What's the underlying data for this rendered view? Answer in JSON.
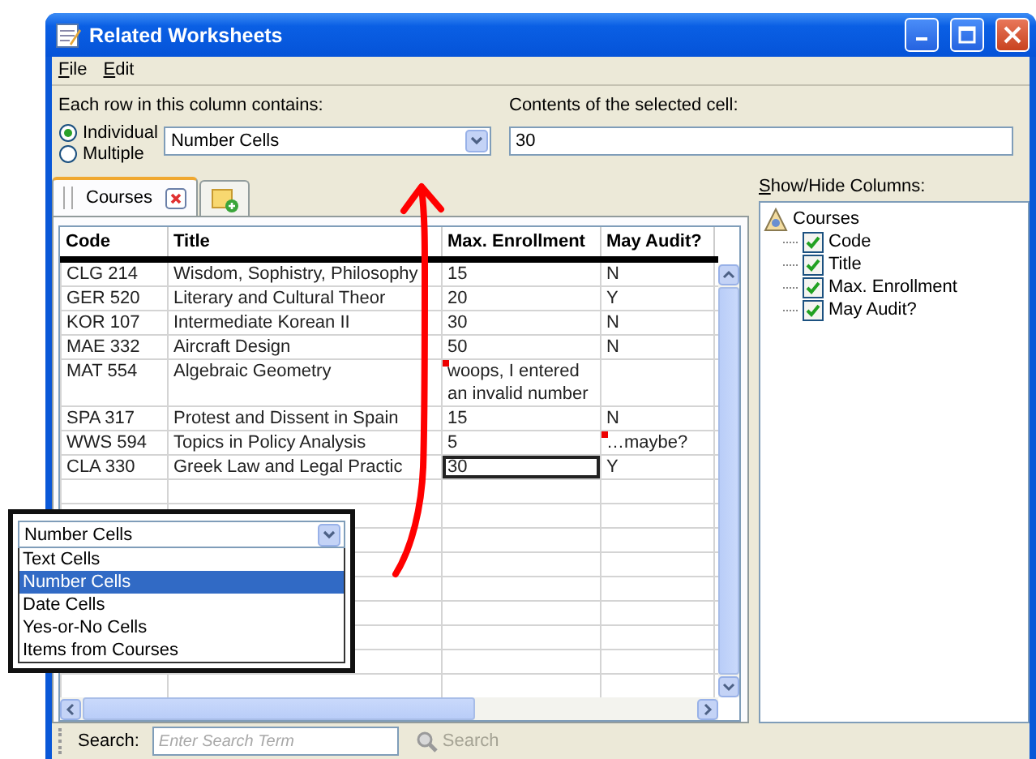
{
  "window": {
    "title": "Related Worksheets"
  },
  "menu": [
    "File",
    "Edit"
  ],
  "row_content": {
    "label": "Each row in this column contains:",
    "options": [
      {
        "label": "Individual",
        "selected": true
      },
      {
        "label": "Multiple",
        "selected": false
      }
    ],
    "type_dropdown": {
      "value": "Number Cells"
    }
  },
  "cell_contents": {
    "label": "Contents of the selected cell:",
    "value": "30"
  },
  "tabs": [
    {
      "kind": "sheet",
      "label": "Courses",
      "selected": true
    },
    {
      "kind": "add",
      "selected": false
    }
  ],
  "table": {
    "columns": [
      "Code",
      "Title",
      "Max. Enrollment",
      "May Audit?"
    ],
    "rows": [
      {
        "cells": [
          {
            "text": "CLG 214",
            "selected": false,
            "flagged": false
          },
          {
            "text": "Wisdom, Sophistry, Philosophy",
            "selected": false,
            "flagged": false
          },
          {
            "text": "15",
            "selected": false,
            "flagged": false
          },
          {
            "text": "N",
            "selected": false,
            "flagged": false
          }
        ]
      },
      {
        "cells": [
          {
            "text": "GER 520",
            "selected": false,
            "flagged": false
          },
          {
            "text": "Literary and Cultural Theor",
            "selected": false,
            "flagged": false
          },
          {
            "text": "20",
            "selected": false,
            "flagged": false
          },
          {
            "text": "Y",
            "selected": false,
            "flagged": false
          }
        ]
      },
      {
        "cells": [
          {
            "text": "KOR 107",
            "selected": false,
            "flagged": false
          },
          {
            "text": "Intermediate Korean II",
            "selected": false,
            "flagged": false
          },
          {
            "text": "30",
            "selected": false,
            "flagged": false
          },
          {
            "text": "N",
            "selected": false,
            "flagged": false
          }
        ]
      },
      {
        "cells": [
          {
            "text": "MAE 332",
            "selected": false,
            "flagged": false
          },
          {
            "text": "Aircraft Design",
            "selected": false,
            "flagged": false
          },
          {
            "text": "50",
            "selected": false,
            "flagged": false
          },
          {
            "text": "N",
            "selected": false,
            "flagged": false
          }
        ]
      },
      {
        "cells": [
          {
            "text": "MAT 554",
            "selected": false,
            "flagged": false
          },
          {
            "text": "Algebraic Geometry",
            "selected": false,
            "flagged": false
          },
          {
            "text": "woops, I entered an invalid number",
            "selected": false,
            "flagged": true
          },
          {
            "text": "",
            "selected": false,
            "flagged": false
          }
        ]
      },
      {
        "cells": [
          {
            "text": "SPA 317",
            "selected": false,
            "flagged": false
          },
          {
            "text": "Protest and Dissent in Spain",
            "selected": false,
            "flagged": false
          },
          {
            "text": "15",
            "selected": false,
            "flagged": false
          },
          {
            "text": "N",
            "selected": false,
            "flagged": false
          }
        ]
      },
      {
        "cells": [
          {
            "text": "WWS 594",
            "selected": false,
            "flagged": false
          },
          {
            "text": "Topics in Policy Analysis",
            "selected": false,
            "flagged": false
          },
          {
            "text": "5",
            "selected": false,
            "flagged": false
          },
          {
            "text": "…maybe?",
            "selected": false,
            "flagged": true
          }
        ]
      },
      {
        "cells": [
          {
            "text": "CLA 330",
            "selected": false,
            "flagged": false
          },
          {
            "text": "Greek Law and Legal Practic",
            "selected": false,
            "flagged": false
          },
          {
            "text": "30",
            "selected": true,
            "flagged": false
          },
          {
            "text": "Y",
            "selected": false,
            "flagged": false
          }
        ]
      }
    ]
  },
  "column_panel": {
    "label": "Show/Hide Columns:",
    "tree": [
      {
        "label": "Courses",
        "children": [
          {
            "label": "Code",
            "checked": true
          },
          {
            "label": "Title",
            "checked": true
          },
          {
            "label": "Max. Enrollment",
            "checked": true
          },
          {
            "label": "May Audit?",
            "checked": true
          }
        ]
      }
    ]
  },
  "search": {
    "label": "Search:",
    "placeholder": "Enter Search Term",
    "button": "Search",
    "button_disabled": true
  },
  "dropdown_inset": {
    "value": "Number Cells",
    "options": [
      {
        "label": "Text Cells",
        "selected": false
      },
      {
        "label": "Number Cells",
        "selected": true
      },
      {
        "label": "Date Cells",
        "selected": false
      },
      {
        "label": "Yes-or-No Cells",
        "selected": false
      },
      {
        "label": "Items from Courses",
        "selected": false
      }
    ]
  }
}
